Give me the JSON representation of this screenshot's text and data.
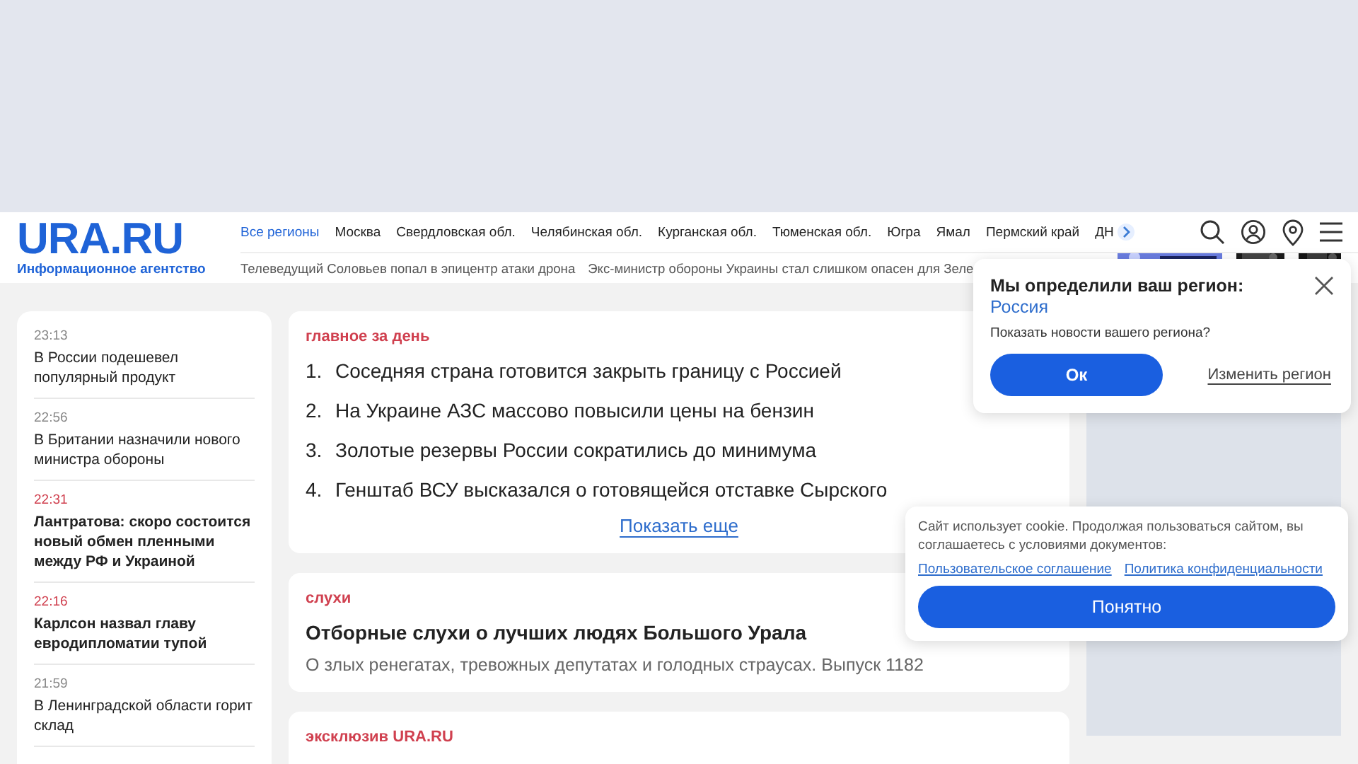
{
  "logo": {
    "title": "URA.RU",
    "subtitle": "Информационное агентство"
  },
  "regions": [
    {
      "label": "Все регионы",
      "selected": true
    },
    {
      "label": "Москва",
      "selected": false
    },
    {
      "label": "Свердловская обл.",
      "selected": false
    },
    {
      "label": "Челябинская обл.",
      "selected": false
    },
    {
      "label": "Курганская обл.",
      "selected": false
    },
    {
      "label": "Тюменская обл.",
      "selected": false
    },
    {
      "label": "Югра",
      "selected": false
    },
    {
      "label": "Ямал",
      "selected": false
    },
    {
      "label": "Пермский край",
      "selected": false
    },
    {
      "label": "ДН",
      "selected": false
    }
  ],
  "ticker": [
    "Телеведущий Соловьев попал в эпицентр атаки дрона",
    "Экс-министр обороны Украины стал слишком опасен для Зеле"
  ],
  "feed": [
    {
      "time": "23:13",
      "title": "В России подешевел популярный продукт",
      "highlighted": false
    },
    {
      "time": "22:56",
      "title": "В Британии назначили нового министра обороны",
      "highlighted": false
    },
    {
      "time": "22:31",
      "title": "Лантратова: скоро состоится новый обмен пленными между РФ и Украиной",
      "highlighted": true
    },
    {
      "time": "22:16",
      "title": "Карлсон назвал главу евродипломатии тупой",
      "highlighted": true
    },
    {
      "time": "21:59",
      "title": "В Ленинградской области горит склад",
      "highlighted": false
    }
  ],
  "top_day": {
    "label": "главное за день",
    "items": [
      {
        "num": "1.",
        "title": "Соседняя страна готовится закрыть границу с Россией"
      },
      {
        "num": "2.",
        "title": "На Украине АЗС массово повысили цены на бензин"
      },
      {
        "num": "3.",
        "title": "Золотые резервы России сократились до минимума"
      },
      {
        "num": "4.",
        "title": "Генштаб ВСУ высказался о готовящейся отставке Сырского"
      }
    ],
    "more": "Показать еще"
  },
  "rumors": {
    "label": "слухи",
    "title": "Отборные слухи о лучших людях Большого Урала",
    "text": "О злых ренегатах, тревожных депутатах и голодных страусах. Выпуск 1182"
  },
  "exclusive": {
    "label": "эксклюзив URA.RU"
  },
  "region_popup": {
    "title": "Мы определили ваш регион:",
    "region": "Россия",
    "question": "Показать новости вашего региона?",
    "ok": "Ок",
    "change": "Изменить регион"
  },
  "cookie": {
    "text": "Сайт использует cookie. Продолжая пользоваться сайтом, вы соглашаетесь с условиями документов:",
    "links": [
      "Пользовательское соглашение",
      "Политика конфиденциальности"
    ],
    "button": "Понятно"
  }
}
